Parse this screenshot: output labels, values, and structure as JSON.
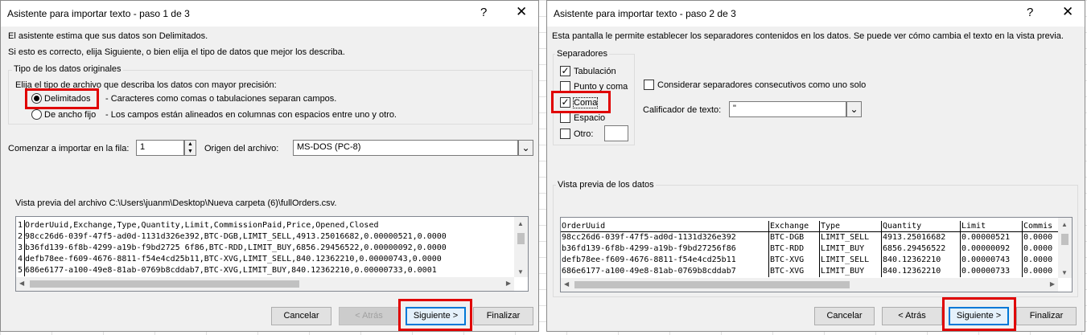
{
  "dialog1": {
    "title": "Asistente para importar texto - paso 1 de 3",
    "help_icon": "?",
    "close_icon": "✕",
    "intro1": "El asistente estima que sus datos son Delimitados.",
    "intro2": "Si esto es correcto, elija Siguiente, o bien elija el tipo de datos que mejor los describa.",
    "group_title": "Tipo de los datos originales",
    "group_prompt": "Elija el tipo de archivo que describa los datos con mayor precisión:",
    "options": [
      {
        "label": "Delimitados",
        "desc": "- Caracteres como comas o tabulaciones separan campos.",
        "checked": true
      },
      {
        "label": "De ancho fijo",
        "desc": "- Los campos están alineados en columnas con espacios entre uno y otro.",
        "checked": false
      }
    ],
    "start_row_label": "Comenzar a importar en la fila:",
    "start_row_value": "1",
    "origin_label": "Origen del archivo:",
    "origin_value": "MS-DOS (PC-8)",
    "preview_label": "Vista previa del archivo C:\\Users\\juanm\\Desktop\\Nueva carpeta (6)\\fullOrders.csv.",
    "preview_lines": [
      {
        "num": "1",
        "text": "OrderUuid,Exchange,Type,Quantity,Limit,CommissionPaid,Price,Opened,Closed"
      },
      {
        "num": "2",
        "text": "98cc26d6-039f-47f5-ad0d-1131d326e392,BTC-DGB,LIMIT_SELL,4913.25016682,0.00000521,0.0000"
      },
      {
        "num": "3",
        "text": "b36fd139-6f8b-4299-a19b-f9bd2725 6f86,BTC-RDD,LIMIT_BUY,6856.29456522,0.00000092,0.0000"
      },
      {
        "num": "4",
        "text": "defb78ee-f609-4676-8811-f54e4cd25b11,BTC-XVG,LIMIT_SELL,840.12362210,0.00000743,0.0000"
      },
      {
        "num": "5",
        "text": "686e6177-a100-49e8-81ab-0769b8cddab7,BTC-XVG,LIMIT_BUY,840.12362210,0.00000733,0.0001"
      }
    ],
    "buttons": {
      "cancel": "Cancelar",
      "back": "< Atrás",
      "next": "Siguiente >",
      "finish": "Finalizar"
    }
  },
  "dialog2": {
    "title": "Asistente para importar texto - paso 2 de 3",
    "help_icon": "?",
    "close_icon": "✕",
    "intro": "Esta pantalla le permite establecer los separadores contenidos en los datos. Se puede ver cómo cambia el texto en la vista previa.",
    "separators_title": "Separadores",
    "separators": [
      {
        "label": "Tabulación",
        "checked": true
      },
      {
        "label": "Punto y coma",
        "checked": false
      },
      {
        "label": "Coma",
        "checked": true
      },
      {
        "label": "Espacio",
        "checked": false
      },
      {
        "label": "Otro:",
        "checked": false
      }
    ],
    "consecutive_label": "Considerar separadores consecutivos como uno solo",
    "consecutive_checked": false,
    "qualifier_label": "Calificador de texto:",
    "qualifier_value": "\"",
    "preview_title": "Vista previa de los datos",
    "columns": [
      "OrderUuid",
      "Exchange",
      "Type",
      "Quantity",
      "Limit",
      "Commis"
    ],
    "rows": [
      [
        "98cc26d6-039f-47f5-ad0d-1131d326e392",
        "BTC-DGB",
        "LIMIT_SELL",
        "4913.25016682",
        "0.00000521",
        "0.0000"
      ],
      [
        "b36fd139-6f8b-4299-a19b-f9bd27256f86",
        "BTC-RDD",
        "LIMIT_BUY",
        "6856.29456522",
        "0.00000092",
        "0.0000"
      ],
      [
        "defb78ee-f609-4676-8811-f54e4cd25b11",
        "BTC-XVG",
        "LIMIT_SELL",
        "840.12362210",
        "0.00000743",
        "0.0000"
      ],
      [
        "686e6177-a100-49e8-81ab-0769b8cddab7",
        "BTC-XVG",
        "LIMIT_BUY",
        "840.12362210",
        "0.00000733",
        "0.0000"
      ]
    ],
    "buttons": {
      "cancel": "Cancelar",
      "back": "< Atrás",
      "next": "Siguiente >",
      "finish": "Finalizar"
    }
  },
  "colors": {
    "highlight": "#e00000",
    "default_button_border": "#0078d7",
    "dialog_bg": "#f0f0f0"
  }
}
